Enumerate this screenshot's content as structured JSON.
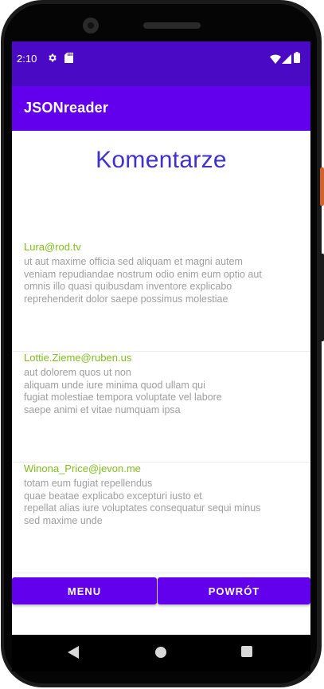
{
  "status": {
    "time": "2:10"
  },
  "app": {
    "title": "JSONreader"
  },
  "page": {
    "heading": "Komentarze"
  },
  "comments": [
    {
      "email": "Lura@rod.tv",
      "body": "ut aut maxime officia sed aliquam et magni autem\nveniam repudiandae nostrum odio enim eum optio aut\nomnis illo quasi quibusdam inventore explicabo\nreprehenderit dolor saepe possimus molestiae"
    },
    {
      "email": "Lottie.Zieme@ruben.us",
      "body": "aut dolorem quos ut non\naliquam unde iure minima quod ullam qui\nfugiat molestiae tempora voluptate vel labore\nsaepe animi et vitae numquam ipsa"
    },
    {
      "email": "Winona_Price@jevon.me",
      "body": "totam eum fugiat repellendus\nquae beatae explicabo excepturi iusto et\nrepellat alias iure voluptates consequatur sequi minus\nsed maxime unde"
    }
  ],
  "buttons": {
    "menu_label": "MENU",
    "back_label": "POWRÓT"
  },
  "colors": {
    "status_bar": "#4a09c4",
    "app_bar": "#6200ee",
    "heading": "#3f31cc",
    "email": "#80bd1e",
    "body_text": "#9e9e9e"
  },
  "icons": {
    "status_left": [
      "settings-gear-icon",
      "sd-card-icon"
    ],
    "status_right": [
      "wifi-icon",
      "cellular-signal-icon",
      "battery-icon"
    ],
    "nav": [
      "back-triangle-icon",
      "home-circle-icon",
      "recents-square-icon"
    ]
  }
}
